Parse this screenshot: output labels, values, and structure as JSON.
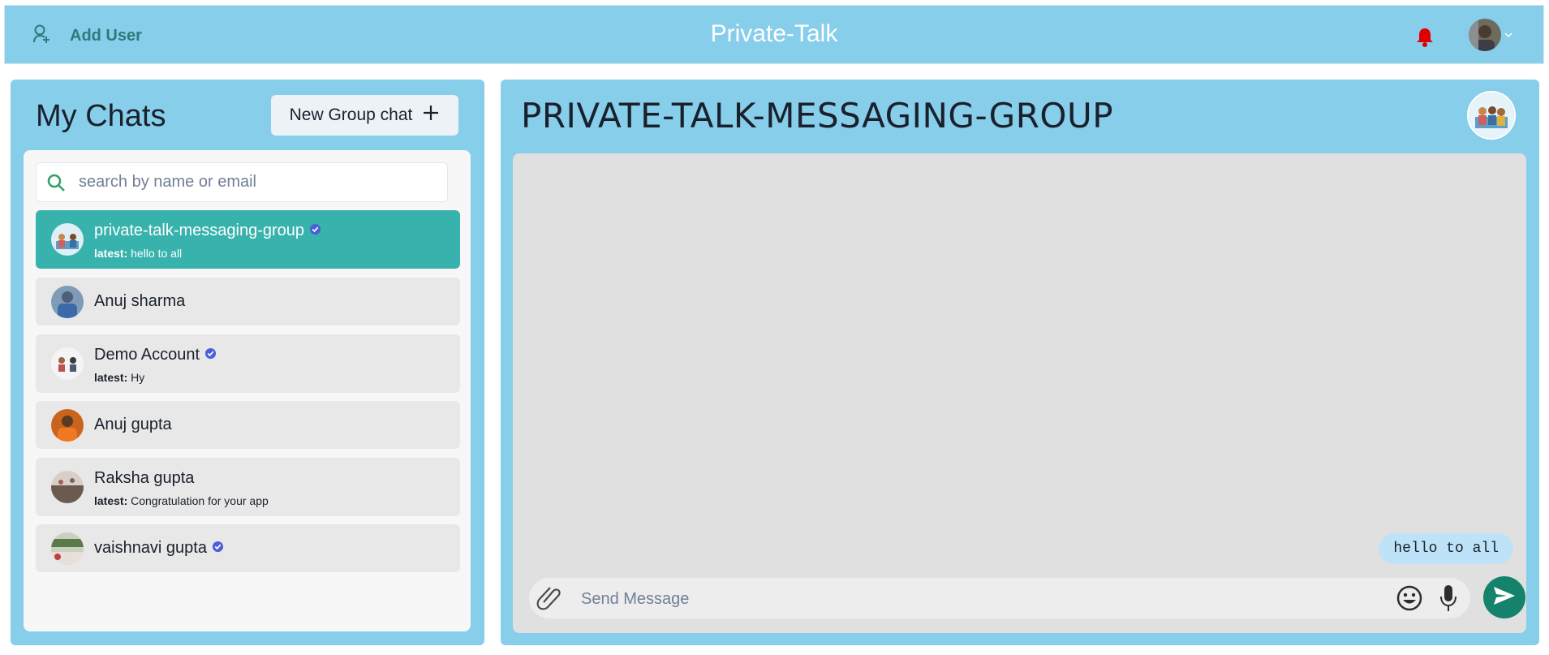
{
  "header": {
    "add_user_label": "Add User",
    "app_title": "Private-Talk"
  },
  "sidebar": {
    "title": "My Chats",
    "new_group_label": "New Group chat",
    "search_placeholder": "search by name or email",
    "chats": [
      {
        "name": "private-talk-messaging-group",
        "verified": true,
        "latest_prefix": "latest:",
        "latest": "hello to all",
        "active": true
      },
      {
        "name": "Anuj sharma",
        "verified": false,
        "latest_prefix": "",
        "latest": "",
        "active": false
      },
      {
        "name": "Demo Account",
        "verified": true,
        "latest_prefix": "latest:",
        "latest": "Hy",
        "active": false
      },
      {
        "name": "Anuj gupta",
        "verified": false,
        "latest_prefix": "",
        "latest": "",
        "active": false
      },
      {
        "name": "Raksha gupta",
        "verified": false,
        "latest_prefix": "latest:",
        "latest": "Congratulation for your app",
        "active": false
      },
      {
        "name": "vaishnavi gupta",
        "verified": true,
        "latest_prefix": "",
        "latest": "",
        "active": false
      }
    ]
  },
  "chat": {
    "title": "PRIVATE-TALK-MESSAGING-GROUP",
    "messages": [
      {
        "text": "hello to all",
        "own": true
      }
    ],
    "input_placeholder": "Send Message"
  },
  "colors": {
    "panel_bg": "#87ceeb",
    "active_chat": "#38b2ac",
    "send_button": "#15836b",
    "notification": "#e00000",
    "verified": "#4a5fd8"
  }
}
